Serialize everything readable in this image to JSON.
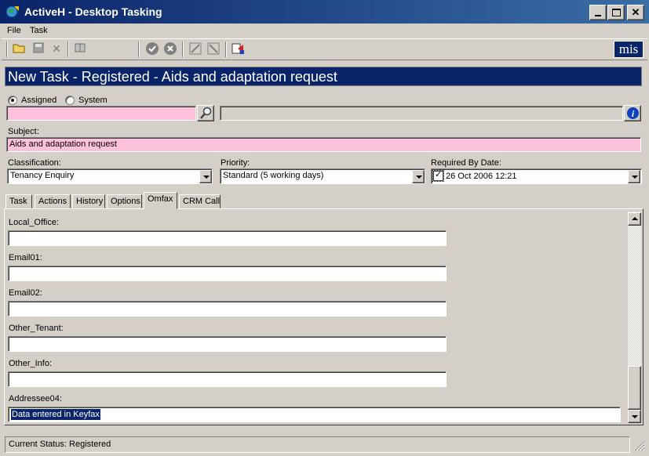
{
  "window": {
    "title": "ActiveH - Desktop Tasking"
  },
  "menu": {
    "items": [
      "File",
      "Task"
    ]
  },
  "toolbar": {
    "logo": "mis"
  },
  "header": {
    "title": "New Task - Registered - Aids and adaptation request"
  },
  "assign": {
    "options": [
      {
        "label": "Assigned",
        "selected": true
      },
      {
        "label": "System",
        "selected": false
      }
    ],
    "user_value": "",
    "info_value": ""
  },
  "subject": {
    "label": "Subject:",
    "value": "Aids and adaptation request"
  },
  "classification": {
    "label": "Classification:",
    "value": "Tenancy Enquiry"
  },
  "priority": {
    "label": "Priority:",
    "value": "Standard (5 working days)"
  },
  "required_by": {
    "label": "Required By Date:",
    "checked": true,
    "value": "26  Oct  2006 12:21"
  },
  "tabs": [
    {
      "label": "Task",
      "active": false
    },
    {
      "label": "Actions",
      "active": false
    },
    {
      "label": "History",
      "active": false
    },
    {
      "label": "Options",
      "active": false
    },
    {
      "label": "Omfax",
      "active": true
    },
    {
      "label": "CRM Call",
      "active": false
    }
  ],
  "omfax_fields": [
    {
      "label": "Local_Office:",
      "value": ""
    },
    {
      "label": "Email01:",
      "value": ""
    },
    {
      "label": "Email02:",
      "value": ""
    },
    {
      "label": "Other_Tenant:",
      "value": ""
    },
    {
      "label": "Other_Info:",
      "value": ""
    },
    {
      "label": "Addressee04:",
      "value": "Data entered in Keyfax"
    }
  ],
  "status": {
    "text": "Current Status: Registered"
  },
  "colors": {
    "title_bar": "#0a246a",
    "required_field": "#ffc0dc",
    "selection": "#0a246a"
  }
}
